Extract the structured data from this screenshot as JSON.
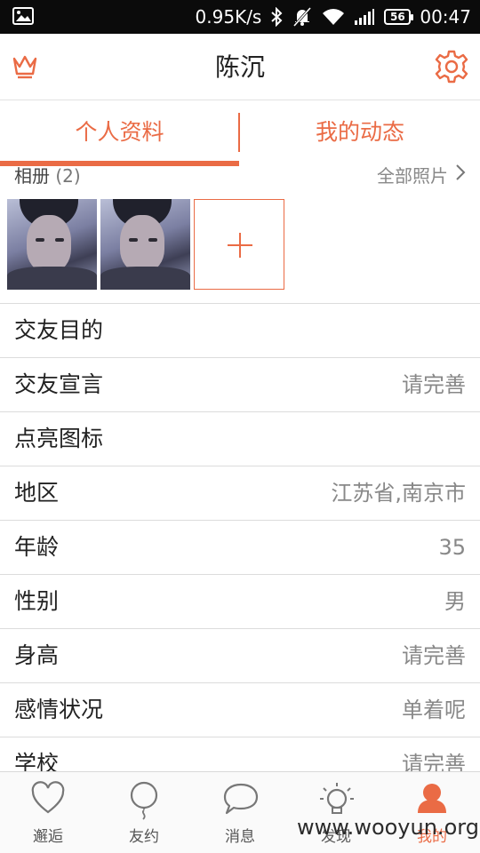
{
  "status_bar": {
    "speed": "0.95K/s",
    "battery": "56",
    "time": "00:47"
  },
  "header": {
    "title": "陈沉"
  },
  "tabs": [
    {
      "label": "个人资料",
      "active": true
    },
    {
      "label": "我的动态",
      "active": false
    }
  ],
  "album": {
    "title": "相册",
    "count": "(2)",
    "more_label": "全部照片"
  },
  "profile_rows": [
    {
      "label": "交友目的",
      "value": ""
    },
    {
      "label": "交友宣言",
      "value": "请完善"
    },
    {
      "label": "点亮图标",
      "value": ""
    },
    {
      "label": "地区",
      "value": "江苏省,南京市"
    },
    {
      "label": "年龄",
      "value": "35"
    },
    {
      "label": "性别",
      "value": "男"
    },
    {
      "label": "身高",
      "value": "请完善"
    },
    {
      "label": "感情状况",
      "value": "单着呢"
    },
    {
      "label": "学校",
      "value": "请完善"
    }
  ],
  "bottom_nav": [
    {
      "label": "邂逅",
      "icon": "heart-icon"
    },
    {
      "label": "友约",
      "icon": "balloon-icon"
    },
    {
      "label": "消息",
      "icon": "chat-bubble-icon"
    },
    {
      "label": "发现",
      "icon": "lightbulb-icon"
    },
    {
      "label": "我的",
      "icon": "person-icon",
      "active": true
    }
  ],
  "watermark": "www.wooyun.org",
  "colors": {
    "accent": "#ea6b45",
    "status_bar": "#0b0b0b",
    "muted_text": "#888888"
  }
}
